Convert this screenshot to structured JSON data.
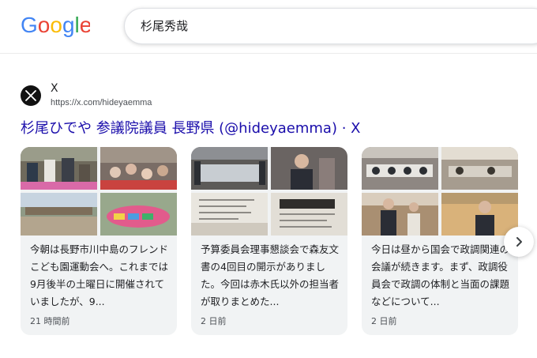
{
  "header": {
    "logo_text": "Google",
    "search_value": "杉尾秀哉"
  },
  "result": {
    "site_name": "X",
    "site_url": "https://x.com/hideyaemma",
    "title": "杉尾ひでや 参議院議員 長野県 (@hideyaemma) · X"
  },
  "cards": [
    {
      "text": "今朝は長野市川中島のフレンドこども園運動会へ。これまでは9月後半の土曜日に開催されていましたが、9...",
      "time": "21 時間前"
    },
    {
      "text": "予算委員会理事懇談会で森友文書の4回目の開示がありました。今回は赤木氏以外の担当者が取りまとめた...",
      "time": "2 日前"
    },
    {
      "text": "今日は昼から国会で政調関連の会議が続きます。まず、政調役員会で政調の体制と当面の課題などについて...",
      "time": "2 日前"
    }
  ],
  "icons": {
    "site": "x-logo-icon",
    "next": "chevron-right-icon"
  },
  "colors": {
    "link": "#1a0dab",
    "card_bg": "#f1f3f4",
    "google_blue": "#4285F4",
    "google_red": "#EA4335",
    "google_yellow": "#FBBC05",
    "google_green": "#34A853"
  }
}
